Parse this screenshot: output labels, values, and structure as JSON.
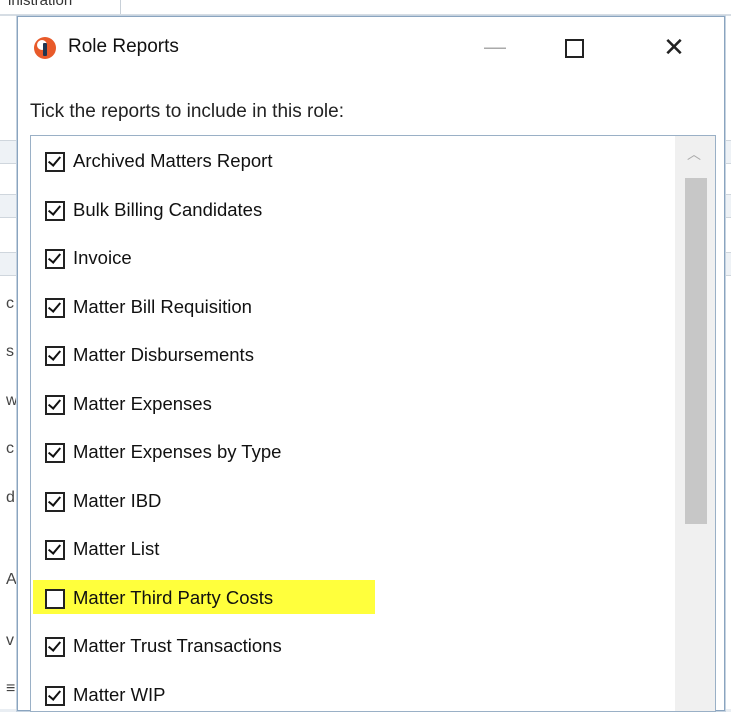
{
  "background": {
    "tab_label": "inistration",
    "glyphs": [
      "c",
      "s",
      "w",
      "c",
      "d",
      "A",
      "v",
      "≡"
    ]
  },
  "dialog": {
    "title": "Role Reports",
    "icon": "app-logo-icon",
    "prompt": "Tick the reports to include in this role:",
    "window_controls": {
      "minimize": "—",
      "maximize": "□",
      "close": "✕"
    },
    "highlight_color": "#ffff3c",
    "reports": [
      {
        "label": "Archived Matters Report",
        "checked": true
      },
      {
        "label": "Bulk Billing Candidates",
        "checked": true
      },
      {
        "label": "Invoice",
        "checked": true
      },
      {
        "label": "Matter Bill Requisition",
        "checked": true
      },
      {
        "label": "Matter Disbursements",
        "checked": true
      },
      {
        "label": "Matter Expenses",
        "checked": true
      },
      {
        "label": "Matter Expenses by Type",
        "checked": true
      },
      {
        "label": "Matter IBD",
        "checked": true
      },
      {
        "label": "Matter List",
        "checked": true
      },
      {
        "label": "Matter Third Party Costs",
        "checked": false,
        "highlighted": true
      },
      {
        "label": "Matter Trust Transactions",
        "checked": true
      },
      {
        "label": "Matter WIP",
        "checked": true
      }
    ]
  }
}
